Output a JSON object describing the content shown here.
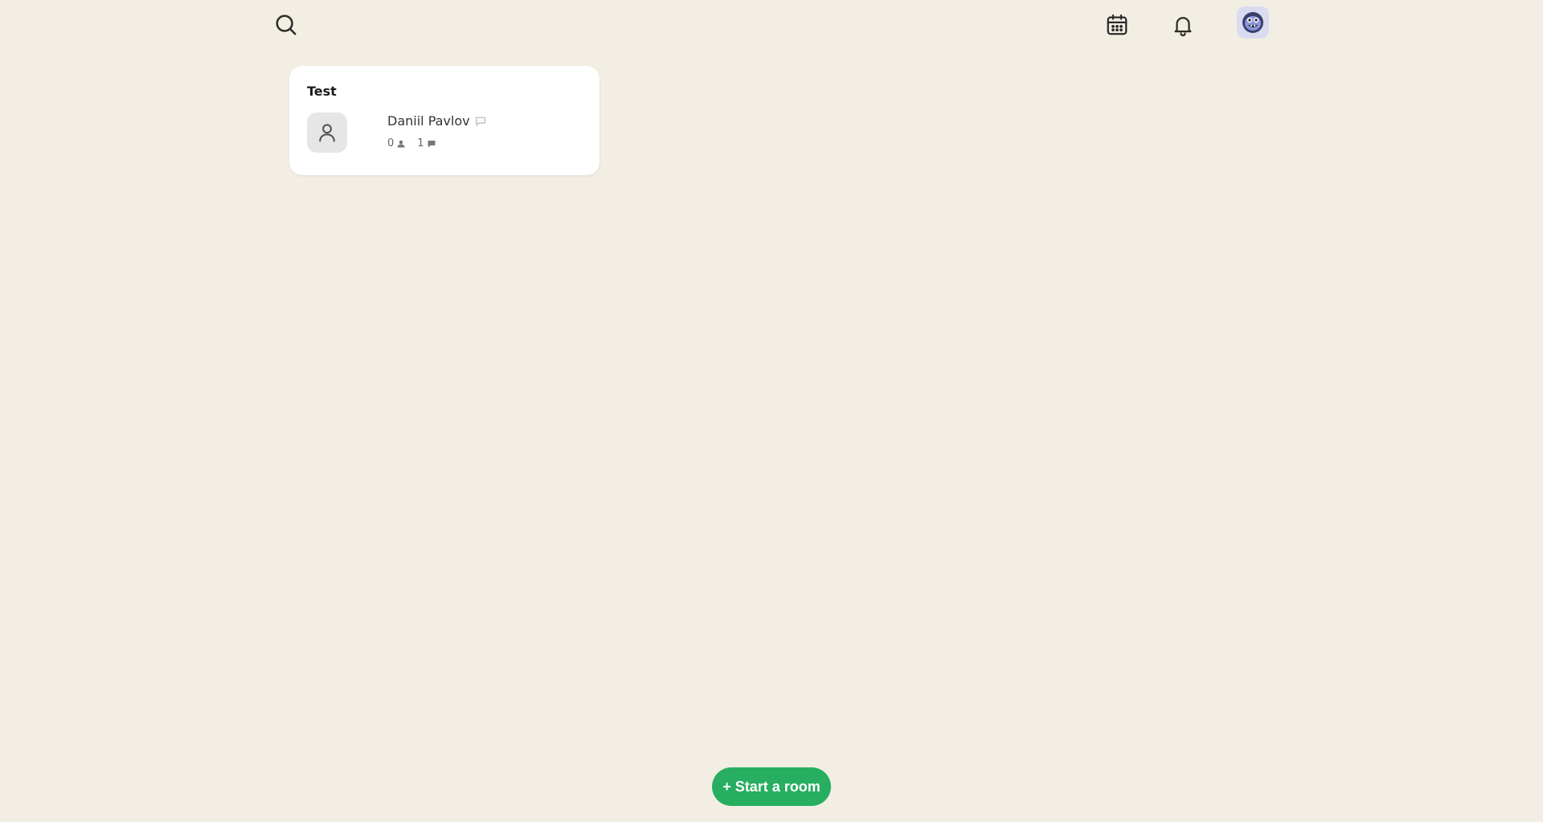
{
  "header": {
    "search_icon": "search-icon",
    "calendar_icon": "calendar-icon",
    "bell_icon": "bell-icon",
    "avatar_icon": "profile-avatar"
  },
  "rooms": [
    {
      "title": "Test",
      "host_name": "Daniil Pavlov",
      "listeners": "0",
      "speakers": "1"
    }
  ],
  "actions": {
    "start_room_label": "+ Start a room"
  },
  "colors": {
    "background": "#f2eee3",
    "card": "#ffffff",
    "accent": "#27ae60",
    "avatar_bg": "#d9dcf0"
  }
}
